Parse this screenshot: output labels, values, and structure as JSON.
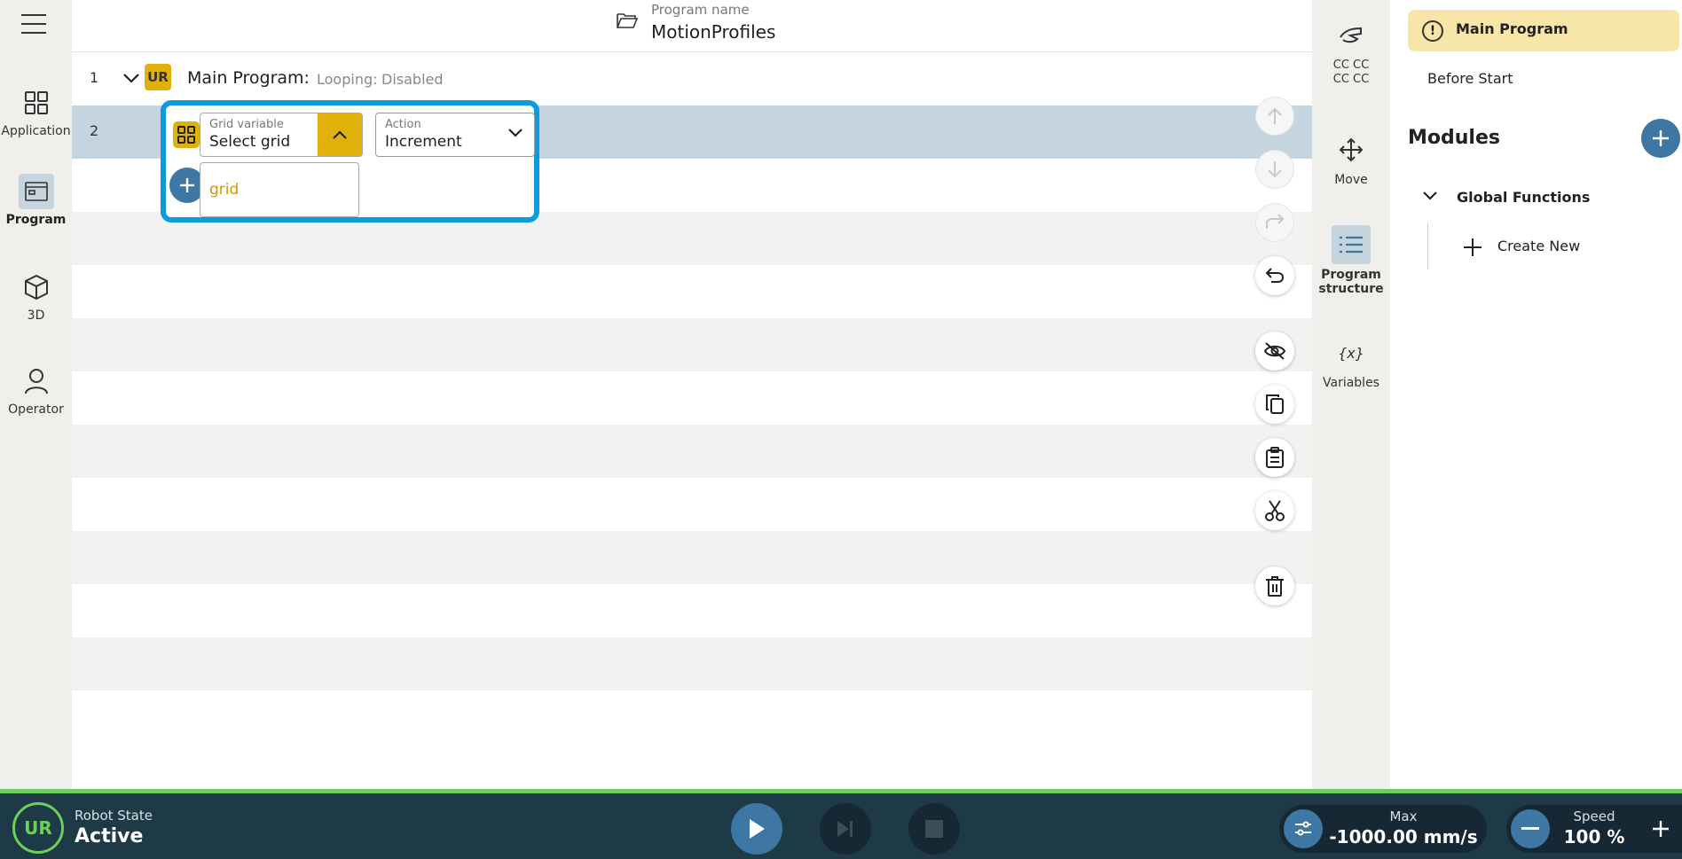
{
  "header": {
    "program_name_label": "Program name",
    "program_name": "MotionProfiles"
  },
  "leftnav": {
    "items": [
      {
        "label": "Application",
        "icon": "grid-apps-icon"
      },
      {
        "label": "Program",
        "icon": "program-window-icon",
        "active": true
      },
      {
        "label": "3D",
        "icon": "cube-icon"
      },
      {
        "label": "Operator",
        "icon": "person-icon"
      }
    ]
  },
  "program": {
    "rows": [
      {
        "number": "1",
        "label": "Main Program:",
        "looping_label": "Looping:",
        "looping_value": "Disabled"
      },
      {
        "number": "2"
      }
    ],
    "node": {
      "grid_variable_label": "Grid variable",
      "grid_variable_value": "Select grid",
      "action_label": "Action",
      "action_value": "Increment",
      "dropdown_items": [
        "grid"
      ]
    }
  },
  "tools": {
    "items": [
      {
        "label_line1": "CC CC",
        "label_line2": "CC CC",
        "icon": "hand-icon"
      },
      {
        "label": "Move",
        "icon": "move-arrows-icon"
      },
      {
        "label_line1": "Program",
        "label_line2": "structure",
        "icon": "list-icon",
        "active": true
      },
      {
        "label": "Variables",
        "icon": "variables-icon",
        "glyph": "{x}"
      }
    ]
  },
  "rpanel": {
    "main_program": "Main Program",
    "before_start": "Before Start",
    "modules_title": "Modules",
    "global_functions": "Global Functions",
    "create_new": "Create New"
  },
  "bottom": {
    "robot_state_label": "Robot State",
    "robot_state_value": "Active",
    "max_label": "Max",
    "max_value": "-1000.00 mm/s",
    "speed_label": "Speed",
    "speed_value": "100 %"
  },
  "colors": {
    "accent_blue": "#3e77a3",
    "highlight_blue": "#0b9be0",
    "ur_yellow": "#e1b10b",
    "status_green": "#6ccf5b",
    "bottom_bar": "#1f3a47"
  }
}
